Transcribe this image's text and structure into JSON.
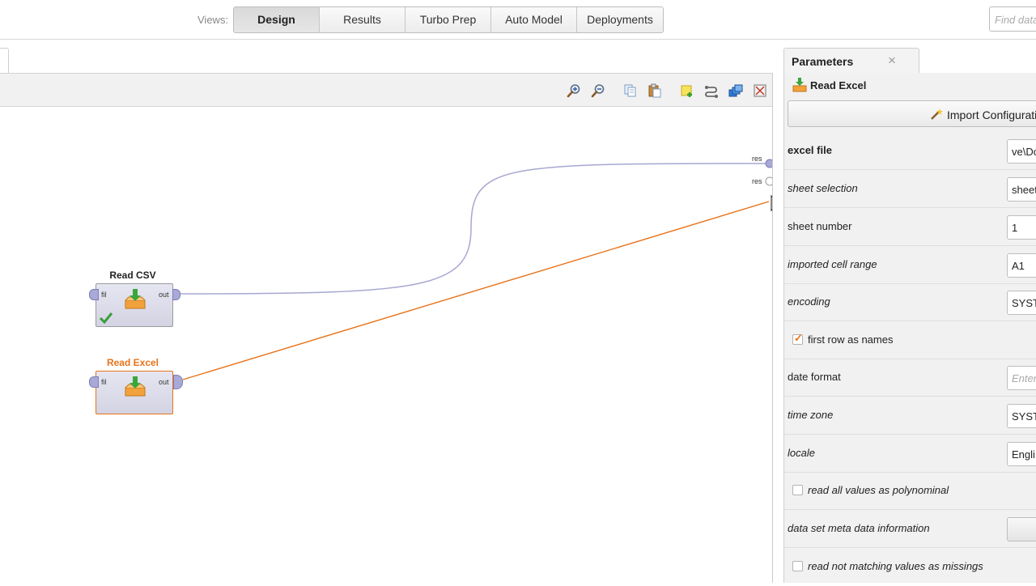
{
  "views": {
    "label": "Views:",
    "tabs": [
      {
        "label": "Design",
        "active": true
      },
      {
        "label": "Results",
        "active": false
      },
      {
        "label": "Turbo Prep",
        "active": false
      },
      {
        "label": "Auto Model",
        "active": false
      },
      {
        "label": "Deployments",
        "active": false
      }
    ]
  },
  "search": {
    "placeholder": "Find data"
  },
  "process": {
    "toolbar_icons": [
      "zoom-in-icon",
      "zoom-out-icon",
      "copy-icon",
      "paste-icon",
      "add-note-icon",
      "auto-wire-icon",
      "arrange-icon",
      "fit-view-icon"
    ],
    "result_ports": [
      "res",
      "res"
    ],
    "operators": [
      {
        "name": "Read CSV",
        "in_port": "fil",
        "out_port": "out",
        "status": "ok",
        "selected": false
      },
      {
        "name": "Read Excel",
        "in_port": "fil",
        "out_port": "out",
        "status": "",
        "selected": true
      }
    ],
    "colors": {
      "selected": "#e8731a",
      "connection_csv": "#a7a7d0",
      "connection_excel": "#e8731a"
    }
  },
  "parameters": {
    "tab_title": "Parameters",
    "close_glyph": "×",
    "operator_name": "Read Excel",
    "import_button": "Import Configuration Wizard",
    "rows": [
      {
        "label": "excel file",
        "value": "ve\\Do",
        "type": "text"
      },
      {
        "label": "sheet selection",
        "value": "sheet",
        "type": "select"
      },
      {
        "label": "sheet number",
        "value": "1",
        "type": "text"
      },
      {
        "label": "imported cell range",
        "value": "A1",
        "type": "text"
      },
      {
        "label": "encoding",
        "value": "SYST",
        "type": "select"
      },
      {
        "label": "first row as names",
        "checked": true,
        "type": "checkbox"
      },
      {
        "label": "date format",
        "placeholder": "Enter",
        "type": "text"
      },
      {
        "label": "time zone",
        "value": "SYST",
        "type": "select"
      },
      {
        "label": "locale",
        "value": "Engli",
        "type": "select"
      },
      {
        "label": "read all values as polynominal",
        "checked": false,
        "type": "checkbox"
      },
      {
        "label": "data set meta data information",
        "type": "button"
      },
      {
        "label": "read not matching values as missings",
        "checked": false,
        "type": "checkbox"
      }
    ]
  }
}
